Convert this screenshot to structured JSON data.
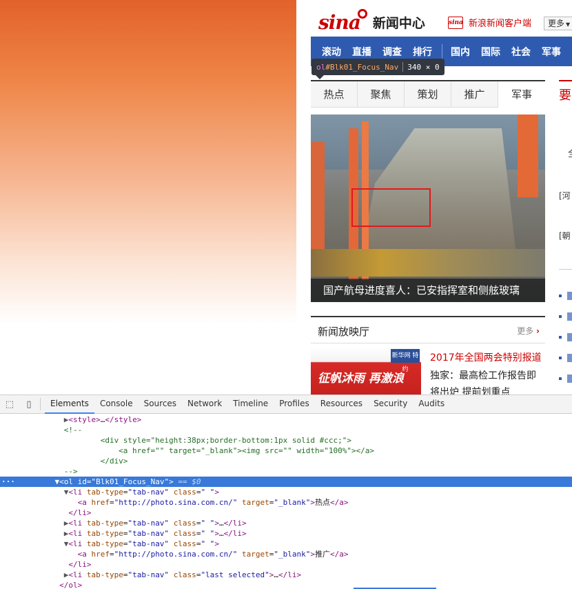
{
  "site": {
    "logo_brand": "sina",
    "logo_text": "新闻中心",
    "client_icon": "sina",
    "client_link": "新浪新闻客户端",
    "more_button": "更多"
  },
  "nav": {
    "group1": [
      "滚动",
      "直播",
      "调查",
      "排行"
    ],
    "group2": [
      "国内",
      "国际",
      "社会",
      "军事"
    ]
  },
  "tooltip": {
    "tag": "ol",
    "id": "#Blk01_Focus_Nav",
    "size": "340 × 0"
  },
  "tabs": [
    "热点",
    "聚焦",
    "策划",
    "推广",
    "军事"
  ],
  "selected_tab": "军事",
  "side": {
    "heading": "要",
    "line1": "全",
    "line2": "[河",
    "line3": "[朝"
  },
  "photo": {
    "caption": "国产航母进度喜人：已安指挥室和侧舷玻璃"
  },
  "video": {
    "title": "新闻放映厅",
    "more": "更多",
    "badge": "新华网 特约",
    "thumb_text": "征帆沐雨 再激浪",
    "links": [
      "2017年全国两会特别报道",
      "独家：最高检工作报告即",
      "将出炉 提前划重点"
    ]
  },
  "devtools": {
    "tabs": [
      "Elements",
      "Console",
      "Sources",
      "Network",
      "Timeline",
      "Profiles",
      "Resources",
      "Security",
      "Audits"
    ],
    "active_tab": "Elements"
  },
  "colors": {
    "sina_red": "#cc0000",
    "nav_blue": "#2e5bb0",
    "devtools_select": "#3879d9"
  }
}
